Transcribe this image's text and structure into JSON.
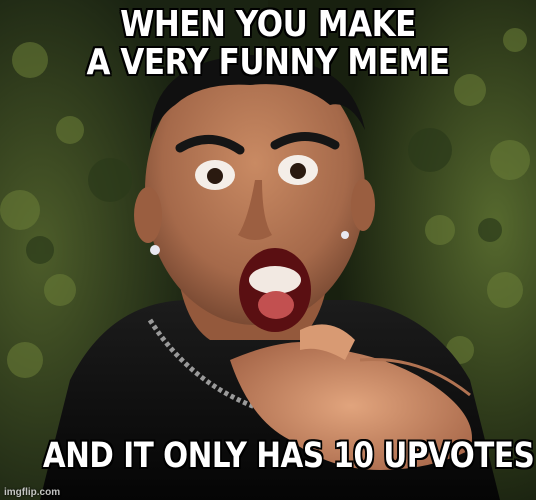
{
  "meme": {
    "top_text_line1": "WHEN YOU MAKE",
    "top_text_line2": "A VERY FUNNY MEME",
    "bottom_text": "AND IT ONLY HAS 10 UPVOTES",
    "watermark": "imgflip.com"
  }
}
